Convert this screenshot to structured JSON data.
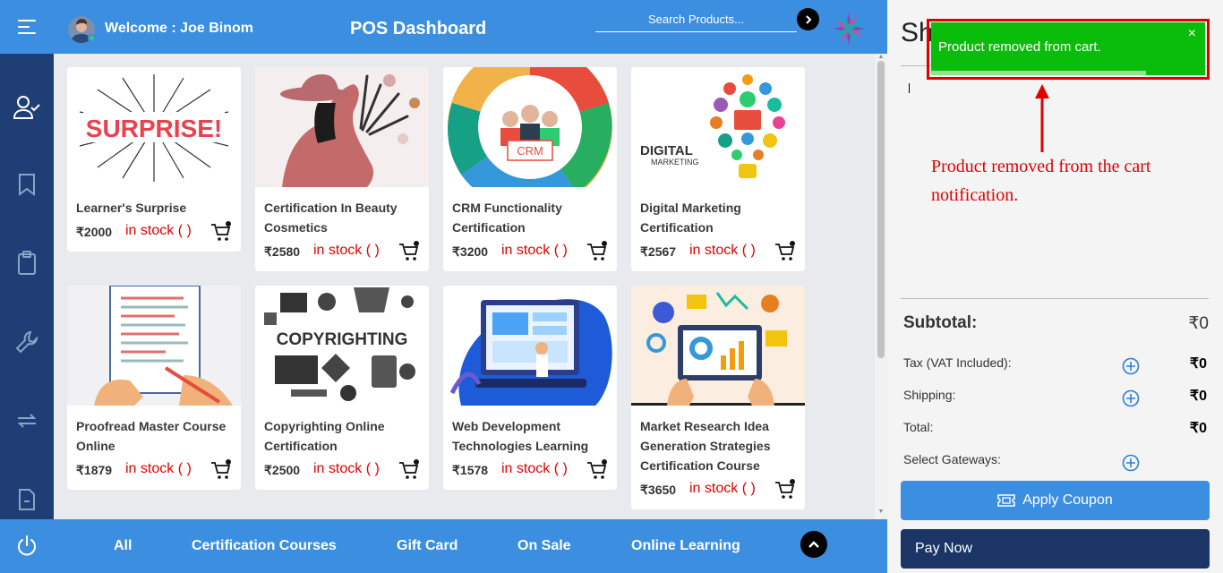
{
  "header": {
    "welcome": "Welcome : Joe Binom",
    "title": "POS Dashboard",
    "search_placeholder": "Search Products..."
  },
  "sidebar": {
    "icons": [
      "menu-icon",
      "user-check-icon",
      "bookmark-icon",
      "clipboard-icon",
      "wrench-icon",
      "repeat-icon",
      "file-icon",
      "power-icon"
    ]
  },
  "products": [
    {
      "name": "Learner's Surprise",
      "price": "₹2000",
      "stock": "in stock ( )"
    },
    {
      "name": "Certification In Beauty Cosmetics",
      "price": "₹2580",
      "stock": "in stock ( )"
    },
    {
      "name": "CRM Functionality Certification",
      "price": "₹3200",
      "stock": "in stock ( )"
    },
    {
      "name": "Digital Marketing Certification",
      "price": "₹2567",
      "stock": "in stock ( )"
    },
    {
      "name": "Proofread Master Course Online",
      "price": "₹1879",
      "stock": "in stock ( )"
    },
    {
      "name": "Copyrighting Online Certification",
      "price": "₹2500",
      "stock": "in stock ( )"
    },
    {
      "name": "Web Development Technologies Learning",
      "price": "₹1578",
      "stock": "in stock ( )"
    },
    {
      "name": "Market Research Idea Generation Strategies Certification Course",
      "price": "₹3650",
      "stock": "in stock ( )"
    }
  ],
  "image_texts": {
    "surprise": "SURPRISE!",
    "crm": "CRM",
    "digital": "DIGITAL",
    "marketing": "MARKETING",
    "copyrighting": "COPYRIGHTING"
  },
  "categories": [
    "All",
    "Certification Courses",
    "Gift Card",
    "On Sale",
    "Online Learning"
  ],
  "cart": {
    "title": "Sh",
    "subtotal_label": "Subtotal:",
    "subtotal_value": "₹0",
    "tax_label": "Tax (VAT Included):",
    "tax_value": "₹0",
    "shipping_label": "Shipping:",
    "shipping_value": "₹0",
    "total_label": "Total:",
    "total_value": "₹0",
    "gateways_label": "Select Gateways:",
    "coupon_label": "Apply Coupon",
    "pay_label": "Pay Now"
  },
  "toast": {
    "message": "Product removed from cart.",
    "close": "×"
  },
  "annotation": "Product removed from the cart notification.",
  "colors": {
    "primary": "#3c8ee0",
    "sidebar": "#1e3e75",
    "stock": "#e00000",
    "toast": "#0bbd0b",
    "pay": "#1a3566"
  }
}
